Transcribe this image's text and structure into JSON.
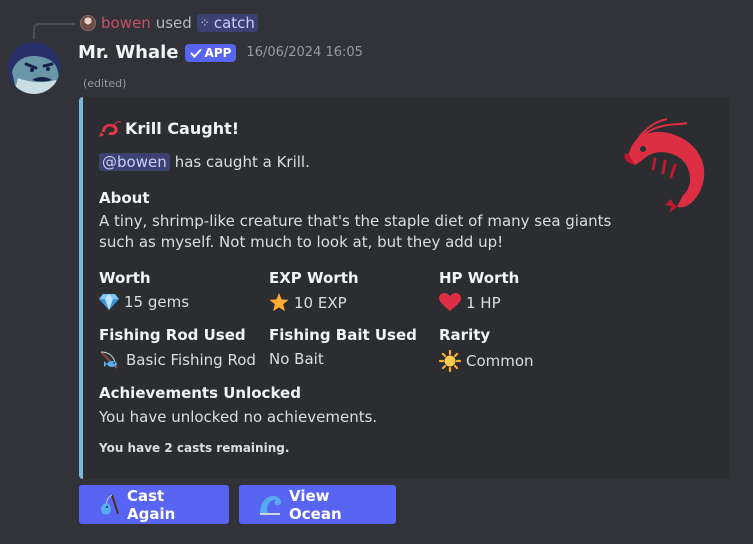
{
  "interaction": {
    "user": "bowen",
    "used_text": "used",
    "command": "catch"
  },
  "message": {
    "author": "Mr. Whale",
    "app_badge": "APP",
    "timestamp": "16/06/2024 16:05",
    "edited": "(edited)"
  },
  "embed": {
    "accent_color": "#7ab8d8",
    "title": "Krill Caught!",
    "mention": "@bowen",
    "description_rest": "has caught a Krill.",
    "fields": [
      {
        "name": "About",
        "value": "A tiny, shrimp-like creature that's the staple diet of many sea giants such as myself. Not much to look at, but they add up!"
      },
      {
        "name": "Worth",
        "value": "15 gems",
        "icon": "gem-icon"
      },
      {
        "name": "EXP Worth",
        "value": "10 EXP",
        "icon": "star-icon"
      },
      {
        "name": "HP Worth",
        "value": "1 HP",
        "icon": "heart-icon"
      },
      {
        "name": "Fishing Rod Used",
        "value": "Basic Fishing Rod",
        "icon": "fishing-rod-icon"
      },
      {
        "name": "Fishing Bait Used",
        "value": "No Bait"
      },
      {
        "name": "Rarity",
        "value": "Common",
        "icon": "sun-icon"
      },
      {
        "name": "Achievements Unlocked",
        "value": "You have unlocked no achievements."
      }
    ],
    "footer": "You have 2 casts remaining."
  },
  "buttons": {
    "cast_again": "Cast Again",
    "view_ocean": "View Ocean"
  },
  "colors": {
    "background": "#313338",
    "embed_bg": "#2b2d31",
    "blurple": "#5865f2",
    "username": "#c45268"
  }
}
